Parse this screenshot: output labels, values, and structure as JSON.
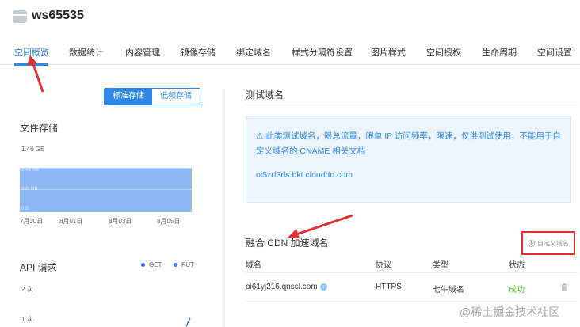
{
  "header": {
    "bucket_name": "ws65535"
  },
  "tabs": [
    {
      "label": "空间概览",
      "active": true
    },
    {
      "label": "数据统计"
    },
    {
      "label": "内容管理"
    },
    {
      "label": "镜像存储"
    },
    {
      "label": "绑定域名"
    },
    {
      "label": "样式分隔符设置"
    },
    {
      "label": "图片样式"
    },
    {
      "label": "空间授权"
    },
    {
      "label": "生命周期"
    },
    {
      "label": "空间设置"
    }
  ],
  "storage_toggle": {
    "standard": "标准存储",
    "low_freq": "低频存储",
    "selected": "标准存储"
  },
  "file_storage": {
    "title": "文件存储",
    "y_top_label": "1.46 GB",
    "inner_labels": [
      "1.46 GB",
      "500 MB",
      "0 B"
    ],
    "x_labels": [
      "7月30日",
      "8月01日",
      "8月03日",
      "8月05日"
    ]
  },
  "api_requests": {
    "title": "API 请求",
    "legend": [
      "GET",
      "PUT"
    ],
    "y_labels": [
      "2 次",
      "1 次"
    ]
  },
  "test_domain": {
    "title": "测试域名",
    "notice": "⚠ 此类测试域名，限总流量，限单 IP 访问频率，限速，仅供测试使用，不能用于自定义域名的 CNAME 相关文档",
    "domain": "oi5zrf3ds.bkt.clouddn.com"
  },
  "cdn": {
    "title": "融合 CDN 加速域名",
    "add_button": "自定义域名",
    "columns": [
      "域名",
      "协议",
      "类型",
      "状态"
    ],
    "rows": [
      {
        "domain": "oi61yj216.qnssl.com",
        "protocol": "HTTPS",
        "type": "七牛域名",
        "status": "成功"
      }
    ]
  },
  "watermark": "@稀土掘金技术社区",
  "colors": {
    "accent": "#2f88e8",
    "annotation": "#e03030",
    "success": "#52c41a",
    "chart_fill": "#8db7f3"
  }
}
